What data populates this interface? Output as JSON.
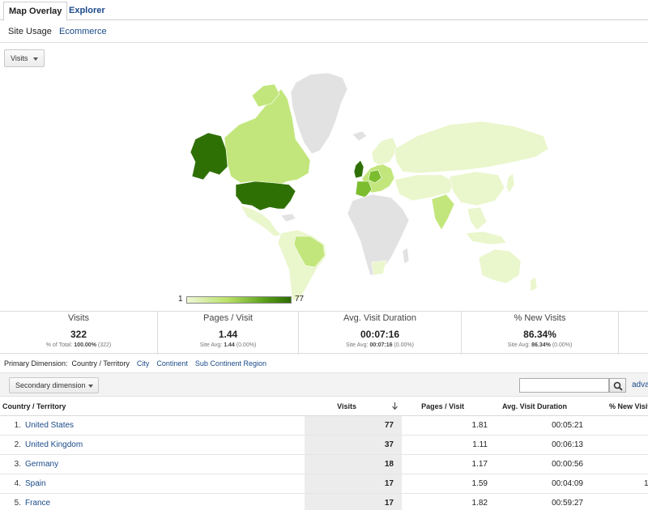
{
  "tabs": [
    {
      "label": "Map Overlay",
      "active": true
    },
    {
      "label": "Explorer",
      "active": false
    }
  ],
  "subtabs": [
    {
      "label": "Site Usage",
      "active": true
    },
    {
      "label": "Ecommerce",
      "active": false
    }
  ],
  "metric_select": {
    "value": "Visits"
  },
  "map": {
    "legend_min": "1",
    "legend_max": "77",
    "colors": {
      "none": "#e2e2e2",
      "light": "#eaf6cc",
      "mid": "#c2e67c",
      "high": "#7bbd2e",
      "max": "#2f7005",
      "border": "#ffffff"
    }
  },
  "summary": [
    {
      "label": "Visits",
      "value": "322",
      "sub_label": "% of Total:",
      "sub_value": "100.00%",
      "sub_extra": "(322)"
    },
    {
      "label": "Pages / Visit",
      "value": "1.44",
      "sub_label": "Site Avg:",
      "sub_value": "1.44",
      "sub_extra": "(0.00%)"
    },
    {
      "label": "Avg. Visit Duration",
      "value": "00:07:16",
      "sub_label": "Site Avg:",
      "sub_value": "00:07:16",
      "sub_extra": "(0.00%)"
    },
    {
      "label": "% New Visits",
      "value": "86.34%",
      "sub_label": "Site Avg:",
      "sub_value": "86.34%",
      "sub_extra": "(0.00%)"
    }
  ],
  "primary_dimension": {
    "label": "Primary Dimension:",
    "active": "Country / Territory",
    "options": [
      "City",
      "Continent",
      "Sub Continent Region"
    ]
  },
  "toolbar": {
    "secondary_dimension": "Secondary dimension",
    "search_value": "",
    "advanced": "adva"
  },
  "table": {
    "headers": {
      "country": "Country / Territory",
      "visits": "Visits",
      "pages": "Pages / Visit",
      "duration": "Avg. Visit Duration",
      "new_visits": "% New Visit"
    },
    "rows": [
      {
        "rank": "1.",
        "country": "United States",
        "visits": "77",
        "pages": "1.81",
        "duration": "00:05:21",
        "new_visits": ""
      },
      {
        "rank": "2.",
        "country": "United Kingdom",
        "visits": "37",
        "pages": "1.11",
        "duration": "00:06:13",
        "new_visits": ""
      },
      {
        "rank": "3.",
        "country": "Germany",
        "visits": "18",
        "pages": "1.17",
        "duration": "00:00:56",
        "new_visits": ""
      },
      {
        "rank": "4.",
        "country": "Spain",
        "visits": "17",
        "pages": "1.59",
        "duration": "00:04:09",
        "new_visits": "1"
      },
      {
        "rank": "5.",
        "country": "France",
        "visits": "17",
        "pages": "1.82",
        "duration": "00:59:27",
        "new_visits": ""
      }
    ]
  }
}
